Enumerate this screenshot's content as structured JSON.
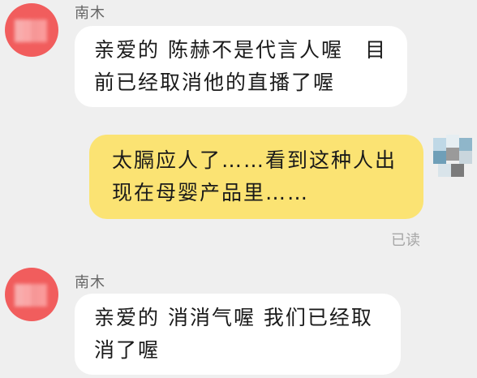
{
  "chat": {
    "messages": [
      {
        "side": "left",
        "sender": "南木",
        "text": "亲爱的 陈赫不是代言人喔　目前已经取消他的直播了喔"
      },
      {
        "side": "right",
        "text": "太膈应人了……看到这种人出现在母婴产品里……",
        "status": "已读"
      },
      {
        "side": "left",
        "sender": "南木",
        "text": "亲爱的 消消气喔 我们已经取消了喔"
      }
    ]
  },
  "colors": {
    "background": "#efefef",
    "incoming_bubble": "#ffffff",
    "outgoing_bubble": "#fbe373",
    "avatar": "#f15d5d",
    "read_status": "#a6a6a6"
  }
}
